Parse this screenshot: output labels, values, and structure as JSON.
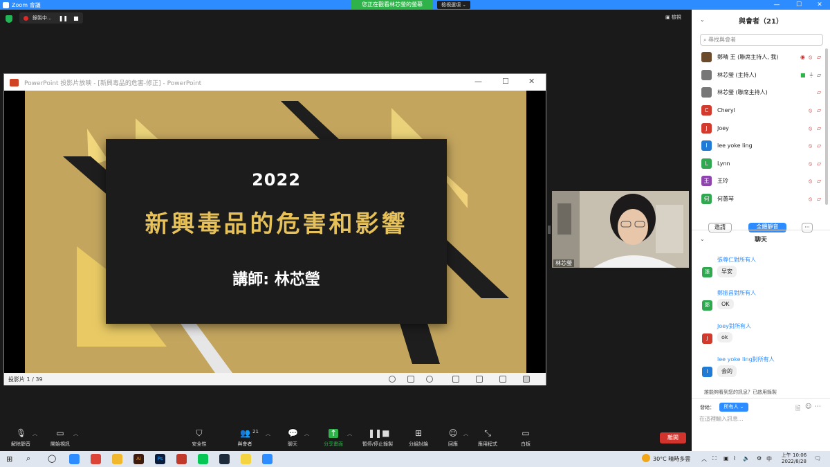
{
  "window": {
    "title": "Zoom 會議",
    "share_banner": "您正在觀看林芯瑩的螢幕",
    "view_options": "檢視選項 ⌄",
    "minimize": "—",
    "maximize": "☐",
    "close": "✕"
  },
  "stage": {
    "recording_label": "錄製中...",
    "pause": "❚❚",
    "stop": "■",
    "view": "▣ 檢視"
  },
  "ppt": {
    "title": "PowerPoint 投影片放映 - [新興毒品的危害-修正] - PowerPoint",
    "slide_counter": "投影片 1 / 39",
    "slide": {
      "year": "2022",
      "title": "新興毒品的危害和影響",
      "instructor": "講師: 林芯瑩"
    }
  },
  "cam": {
    "name": "林芯瑩"
  },
  "toolbar": {
    "items": [
      {
        "label": "解除靜音",
        "icon": "mic-muted-icon"
      },
      {
        "label": "開始視訊",
        "icon": "video-off-icon"
      },
      {
        "label": "安全性",
        "icon": "shield-icon"
      },
      {
        "label": "與會者",
        "icon": "participants-icon",
        "badge": "21"
      },
      {
        "label": "聊天",
        "icon": "chat-icon"
      },
      {
        "label": "分享畫面",
        "icon": "share-screen-icon"
      },
      {
        "label": "暫停/停止錄製",
        "icon": "pause-record-icon"
      },
      {
        "label": "分組討論",
        "icon": "breakout-icon"
      },
      {
        "label": "回應",
        "icon": "reactions-icon"
      },
      {
        "label": "應用程式",
        "icon": "apps-icon"
      },
      {
        "label": "白板",
        "icon": "whiteboard-icon"
      }
    ],
    "end_label": "離開"
  },
  "participants": {
    "header": "與會者（21）",
    "search_placeholder": "尋找與會者",
    "list": [
      {
        "name": "鄭晴 王 (聯席主持人, 我)",
        "avatar": "",
        "color": "#6b4a2b"
      },
      {
        "name": "林芯瑩 (主持人)",
        "avatar": "",
        "color": "#777777"
      },
      {
        "name": "林芯瑩 (聯席主持人)",
        "avatar": "",
        "color": "#777777"
      },
      {
        "name": "Cheryl",
        "avatar": "C",
        "color": "#d13a2c"
      },
      {
        "name": "Joey",
        "avatar": "J",
        "color": "#d13a2c"
      },
      {
        "name": "lee yoke ling",
        "avatar": "l",
        "color": "#1f7bd6"
      },
      {
        "name": "Lynn",
        "avatar": "L",
        "color": "#2fa84f"
      },
      {
        "name": "王玲",
        "avatar": "王",
        "color": "#8e44ad"
      },
      {
        "name": "何蕙琴",
        "avatar": "何",
        "color": "#2fa84f"
      }
    ],
    "invite_label": "邀請",
    "mute_all_label": "全體靜音",
    "more_label": "···"
  },
  "chat": {
    "header": "聊天",
    "messages": [
      {
        "sender": "張尊仁對所有人",
        "avatar": "張",
        "color": "#2fa84f",
        "text": "早安"
      },
      {
        "sender": "鄭振昌對所有人",
        "avatar": "鄭",
        "color": "#2fa84f",
        "text": "OK"
      },
      {
        "sender": "Joey對所有人",
        "avatar": "J",
        "color": "#d13a2c",
        "text": "ok"
      },
      {
        "sender": "lee yoke ling對所有人",
        "avatar": "l",
        "color": "#1f7bd6",
        "text": "会的"
      }
    ],
    "note": "誰能夠看到您的訊息？已啟用錄製",
    "send_to_label": "發給：",
    "send_to_value": "所有人 ⌄",
    "input_placeholder": "在這裡輸入訊息..."
  },
  "taskbar": {
    "weather": "30°C 晴時多雲",
    "time": "上午 10:06",
    "date": "2022/8/28",
    "lang": "中"
  }
}
